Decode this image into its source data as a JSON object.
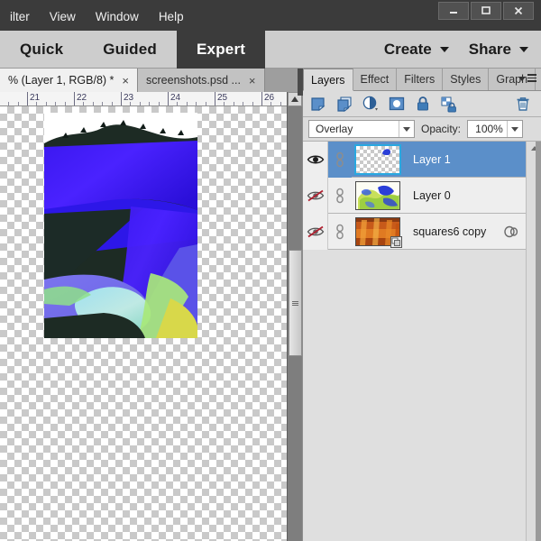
{
  "window": {
    "controls": [
      {
        "name": "minimize",
        "glyph": "minimize-icon"
      },
      {
        "name": "maximize",
        "glyph": "maximize-icon"
      },
      {
        "name": "close",
        "glyph": "close-icon"
      }
    ]
  },
  "menubar": {
    "items": [
      {
        "label": "ilter",
        "mnemonic": ""
      },
      {
        "label": "View",
        "mnemonic": "V"
      },
      {
        "label": "Window",
        "mnemonic": "W"
      },
      {
        "label": "Help",
        "mnemonic": "H"
      }
    ]
  },
  "modebar": {
    "tabs": [
      {
        "label": "Quick",
        "active": false
      },
      {
        "label": "Guided",
        "active": false
      },
      {
        "label": "Expert",
        "active": true
      }
    ],
    "actions": [
      {
        "label": "Create"
      },
      {
        "label": "Share"
      }
    ]
  },
  "document_tabs": [
    {
      "label": "% (Layer 1, RGB/8) *",
      "active": true,
      "close": "×"
    },
    {
      "label": "screenshots.psd ...",
      "active": false,
      "close": "×"
    }
  ],
  "ruler": {
    "unit_marks": [
      "21",
      "22",
      "23",
      "24",
      "25",
      "26"
    ],
    "orientation": "horizontal"
  },
  "panel": {
    "tabs": [
      {
        "label": "Layers",
        "active": true
      },
      {
        "label": "Effect",
        "active": false
      },
      {
        "label": "Filters",
        "active": false
      },
      {
        "label": "Styles",
        "active": false
      },
      {
        "label": "Graph",
        "active": false
      }
    ],
    "menu_icon": "panel-menu-icon",
    "tools": [
      {
        "name": "new-layer-icon",
        "title": "New Layer"
      },
      {
        "name": "duplicate-layer-icon",
        "title": "Duplicate Layer"
      },
      {
        "name": "adjustment-layer-icon",
        "title": "Adjustment Layer"
      },
      {
        "name": "layer-mask-icon",
        "title": "Layer Mask"
      },
      {
        "name": "lock-all-icon",
        "title": "Lock All"
      },
      {
        "name": "lock-transparency-icon",
        "title": "Lock Transparency"
      },
      {
        "name": "delete-layer-icon",
        "title": "Delete Layer"
      }
    ],
    "blend_mode": {
      "value": "Overlay",
      "opacity_label": "Opacity:",
      "opacity_value": "100%"
    },
    "layers": [
      {
        "name": "Layer 1",
        "visible": true,
        "selected": true,
        "linked": true,
        "thumb_type": "transparent",
        "has_fx": false,
        "has_clip_badge": false
      },
      {
        "name": "Layer 0",
        "visible": false,
        "selected": false,
        "linked": true,
        "thumb_type": "art-green-blue",
        "has_fx": false,
        "has_clip_badge": false
      },
      {
        "name": "squares6 copy",
        "visible": false,
        "selected": false,
        "linked": true,
        "thumb_type": "art-orange-red",
        "has_fx": true,
        "has_clip_badge": true
      }
    ]
  },
  "colors": {
    "titlebar": "#3b3b3b",
    "modebar": "#cdcdcd",
    "active_mode": "#3b3b3b",
    "panel_bg": "#dcdcdc",
    "selected_layer": "#5b8fc9",
    "accent_blue": "#29a8e0",
    "hidden_eye_slash": "#b02030",
    "ruler_text": "#3a3a5c"
  }
}
